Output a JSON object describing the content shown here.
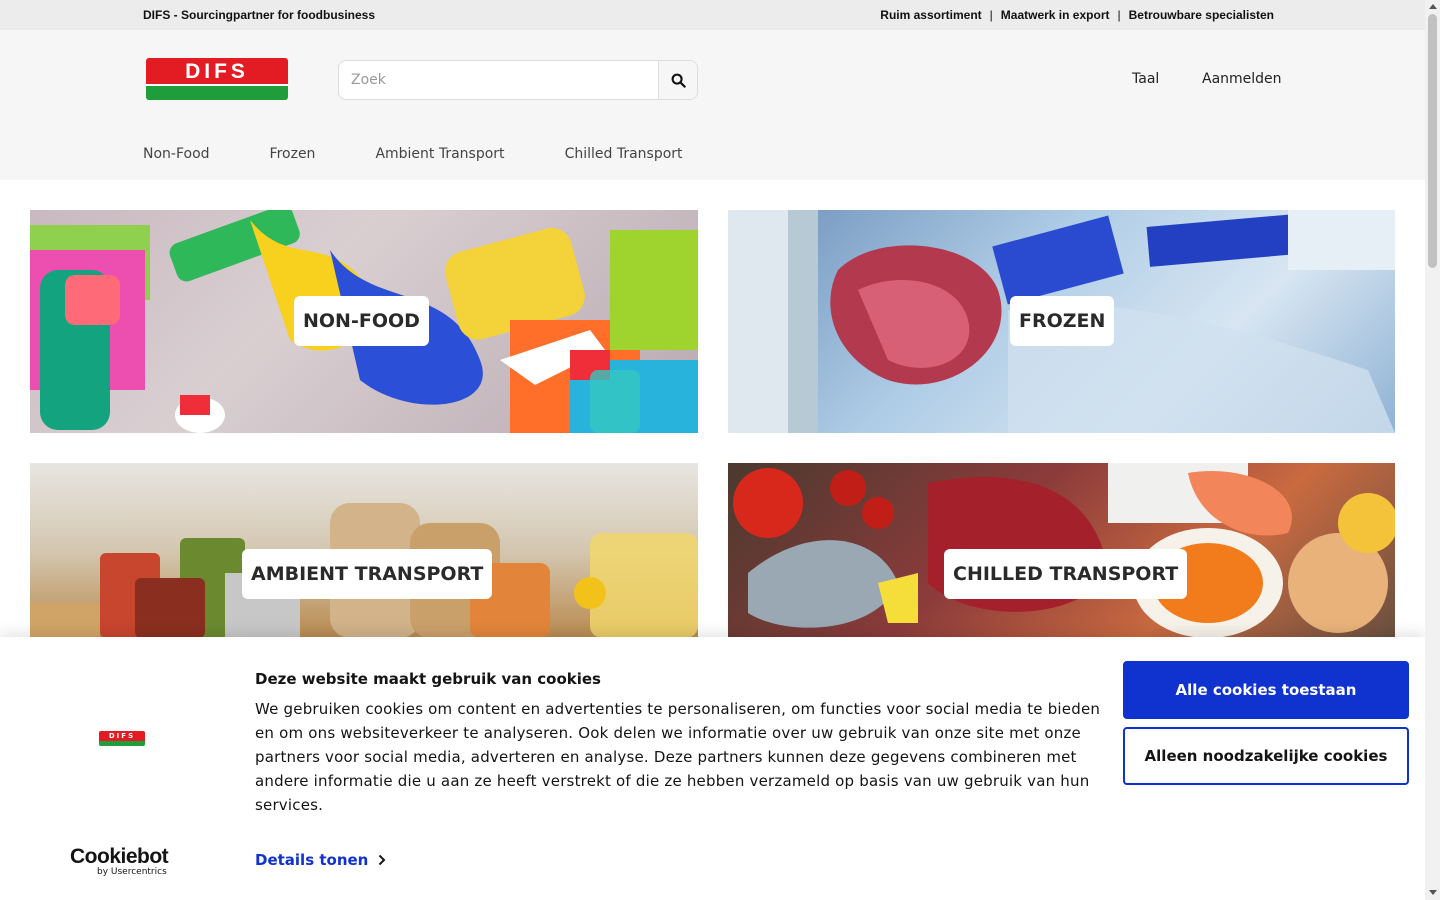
{
  "topbar": {
    "tagline": "DIFS - Sourcingpartner for foodbusiness",
    "usps": [
      "Ruim assortiment",
      "Maatwerk in export",
      "Betrouwbare specialisten"
    ],
    "separator": "|"
  },
  "header": {
    "logo_text": "DIFS",
    "search": {
      "placeholder": "Zoek",
      "value": "",
      "icon": "search-icon"
    },
    "language_label": "Taal",
    "login_label": "Aanmelden"
  },
  "nav": {
    "items": [
      {
        "label": "Non-Food"
      },
      {
        "label": "Frozen"
      },
      {
        "label": "Ambient Transport"
      },
      {
        "label": "Chilled Transport"
      }
    ]
  },
  "categories": [
    {
      "label": "NON-FOOD"
    },
    {
      "label": "FROZEN"
    },
    {
      "label": "AMBIENT TRANSPORT"
    },
    {
      "label": "CHILLED TRANSPORT"
    }
  ],
  "cookie_banner": {
    "title": "Deze website maakt gebruik van cookies",
    "body": "We gebruiken cookies om content en advertenties te personaliseren, om functies voor social media te bieden en om ons websiteverkeer te analyseren. Ook delen we informatie over uw gebruik van onze site met onze partners voor social media, adverteren en analyse. Deze partners kunnen deze gegevens combineren met andere informatie die u aan ze heeft verstrekt of die ze hebben verzameld op basis van uw gebruik van hun services.",
    "details_label": "Details tonen",
    "allow_all_label": "Alle cookies toestaan",
    "necessary_only_label": "Alleen noodzakelijke cookies",
    "brand_name": "Cookiebot",
    "brand_sub": "by Usercentrics",
    "logo_text": "DIFS"
  },
  "colors": {
    "accent_blue": "#1032cf",
    "brand_red": "#e31b23",
    "brand_green": "#1f9d3a"
  }
}
